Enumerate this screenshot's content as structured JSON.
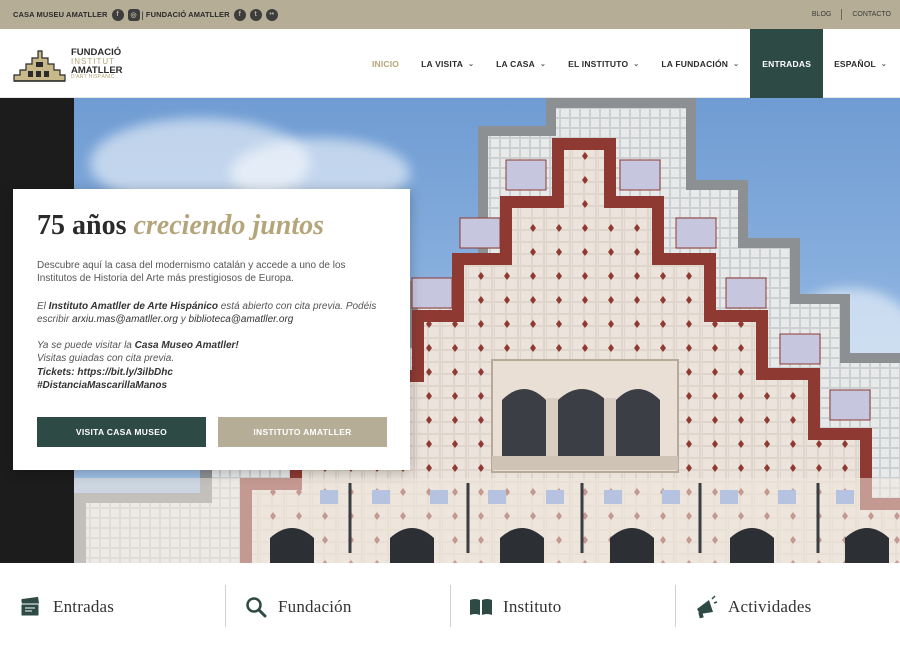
{
  "topbar": {
    "museum_label": "CASA MUSEU AMATLLER",
    "separator": "|",
    "foundation_label": "FUNDACIÓ AMATLLER",
    "links": {
      "blog": "BLOG",
      "contact": "CONTACTO"
    }
  },
  "logo": {
    "line1": "FUNDACIÓ",
    "line2": "INSTITUT",
    "line3": "AMATLLER",
    "line4": "D'ART HISPÀNIC"
  },
  "nav": {
    "items": [
      {
        "label": "INICIO",
        "active": true,
        "dropdown": false
      },
      {
        "label": "LA VISITA",
        "dropdown": true
      },
      {
        "label": "LA CASA",
        "dropdown": true
      },
      {
        "label": "EL INSTITUTO",
        "dropdown": true
      },
      {
        "label": "LA FUNDACIÓN",
        "dropdown": true
      }
    ],
    "cta_label": "ENTRADAS",
    "language_label": "ESPAÑOL"
  },
  "card": {
    "title_main": "75 años",
    "title_accent": "creciendo juntos",
    "intro": "Descubre aquí la casa del modernismo catalán y accede a uno de los Institutos de Historia del Arte más prestigiosos de Europa.",
    "p2_prefix": "El ",
    "p2_bold": "Instituto Amatller de Arte Hispánico",
    "p2_middle": " está abierto con cita previa. Podéis escribir ",
    "p2_email1": "arxiu.mas@amatller.org",
    "p2_and": " y ",
    "p2_email2": "biblioteca@amatller.org",
    "p3_line1_prefix": "Ya se puede visitar la ",
    "p3_line1_bold": "Casa Museo Amatller!",
    "p3_line2": "Visitas guiadas con cita previa.",
    "p3_line3": "Tickets: https://bit.ly/3ilbDhc",
    "p3_line4": "#DistanciaMascarillaManos",
    "button_primary": "VISITA CASA MUSEO",
    "button_secondary": "INSTITUTO AMATLLER"
  },
  "features": [
    {
      "label": "Entradas",
      "icon": "tickets-icon"
    },
    {
      "label": "Fundación",
      "icon": "search-icon"
    },
    {
      "label": "Instituto",
      "icon": "book-icon"
    },
    {
      "label": "Actividades",
      "icon": "megaphone-icon"
    }
  ],
  "colors": {
    "topbar": "#b5ad95",
    "accent_gold": "#b5a57a",
    "dark_green": "#2e4a45",
    "tile_red": "#8e3a33"
  }
}
